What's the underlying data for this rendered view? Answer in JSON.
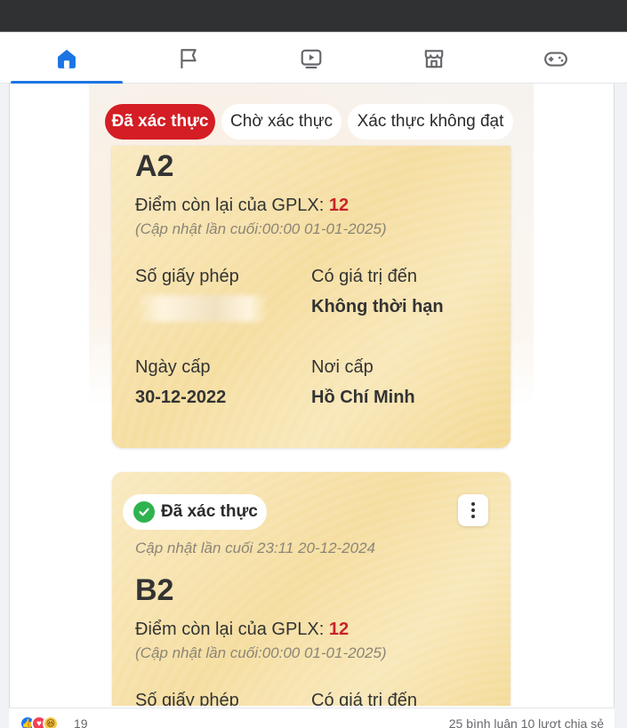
{
  "nav": {
    "items": [
      {
        "name": "home-icon",
        "active": true
      },
      {
        "name": "flag-icon",
        "active": false
      },
      {
        "name": "video-icon",
        "active": false
      },
      {
        "name": "marketplace-icon",
        "active": false
      },
      {
        "name": "gaming-icon",
        "active": false
      }
    ],
    "accent": "#1b74e4"
  },
  "app": {
    "filters": [
      {
        "label": "Đã xác thực",
        "active": true
      },
      {
        "label": "Chờ xác thực",
        "active": false
      },
      {
        "label": "Xác thực không đạt",
        "active": false
      }
    ],
    "accent": "#d41d24"
  },
  "licenses": [
    {
      "class": "A2",
      "points_label": "Điểm còn lại của GPLX: ",
      "points": "12",
      "points_updated": "(Cập nhật lần cuối:00:00 01-01-2025)",
      "license_no_label": "Số giấy phép",
      "valid_until_label": "Có giá trị đến",
      "valid_until": "Không thời hạn",
      "issue_date_label": "Ngày cấp",
      "issue_date": "30-12-2022",
      "issue_place_label": "Nơi cấp",
      "issue_place": "Hồ Chí Minh"
    },
    {
      "status": "Đã xác thực",
      "status_color": "#2fb34e",
      "updated": "Cập nhật lần cuối 23:11 20-12-2024",
      "class": "B2",
      "points_label": "Điểm còn lại của GPLX: ",
      "points": "12",
      "points_updated": "(Cập nhật lần cuối:00:00 01-01-2025)",
      "license_no_label": "Số giấy phép",
      "valid_until_label": "Có giá trị đến"
    }
  ],
  "footer": {
    "reaction_icons": [
      "like-icon",
      "love-icon",
      "haha-icon"
    ],
    "reaction_count": "19",
    "stats": "25 bình luận   10 lượt chia sẻ"
  }
}
